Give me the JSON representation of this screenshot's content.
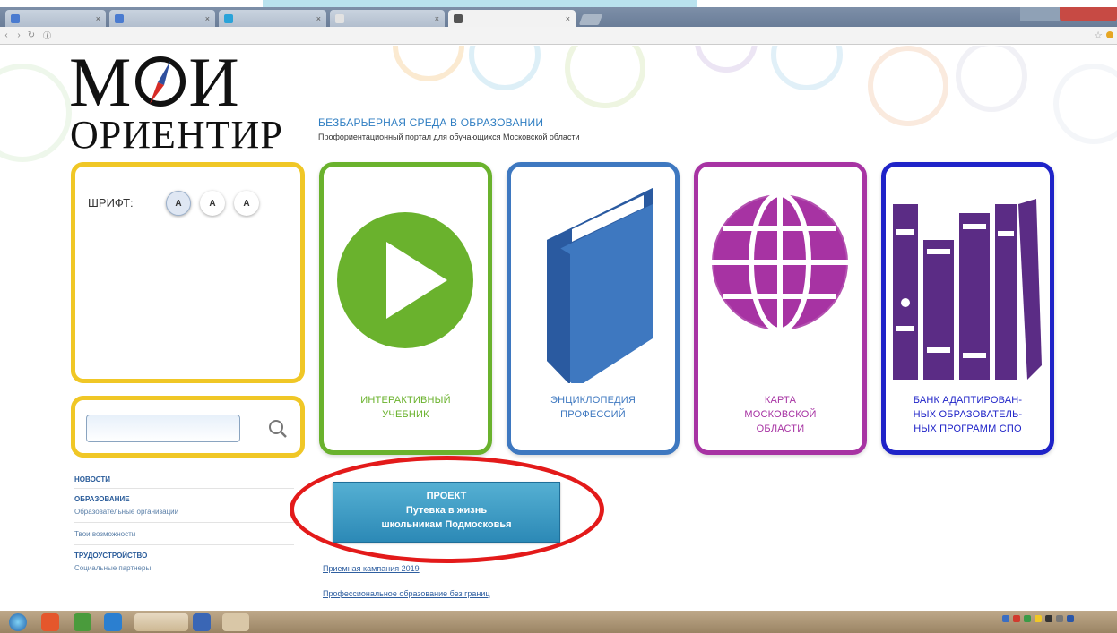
{
  "site": {
    "logo_top": "МИ",
    "logo_bottom": "ОРИЕНТИР",
    "title": "БЕЗБАРЬЕРНАЯ СРЕДА В ОБРАЗОВАНИИ",
    "subtitle": "Профориентационный портал для обучающихся Московской области"
  },
  "font_switcher": {
    "label": "ШРИФТ:",
    "options": [
      "A",
      "A",
      "A"
    ]
  },
  "cards": [
    {
      "label_line1": "ИНТЕРАКТИВНЫЙ",
      "label_line2": "УЧЕБНИК",
      "label_line3": "",
      "color": "#6ab22d"
    },
    {
      "label_line1": "ЭНЦИКЛОПЕДИЯ",
      "label_line2": "ПРОФЕССИЙ",
      "label_line3": "",
      "color": "#3e78c0"
    },
    {
      "label_line1": "КАРТА",
      "label_line2": "МОСКОВСКОЙ",
      "label_line3": "ОБЛАСТИ",
      "color": "#a733a3"
    },
    {
      "label_line1": "БАНК АДАПТИРОВАН-",
      "label_line2": "НЫХ ОБРАЗОВАТЕЛЬ-",
      "label_line3": "НЫХ ПРОГРАММ СПО",
      "color": "#1f23c8"
    }
  ],
  "sidebar": {
    "sections": [
      {
        "heading": "НОВОСТИ",
        "items": []
      },
      {
        "heading": "ОБРАЗОВАНИЕ",
        "items": [
          "Образовательные организации",
          "Твои возможности"
        ]
      },
      {
        "heading": "ТРУДОУСТРОЙСТВО",
        "items": [
          "Социальные партнеры"
        ]
      }
    ]
  },
  "promo": {
    "line1": "ПРОЕКТ",
    "line2": "Путевка в жизнь",
    "line3": "школьникам Подмосковья"
  },
  "links": [
    "Приемная кампания 2019",
    "Профессиональное образование без границ"
  ],
  "colors": {
    "yellow": "#f0c726",
    "green": "#6ab22d",
    "blue": "#3e78c0",
    "purple": "#a733a3",
    "navy": "#1f23c8",
    "highlight_ring": "#e31a1a"
  }
}
